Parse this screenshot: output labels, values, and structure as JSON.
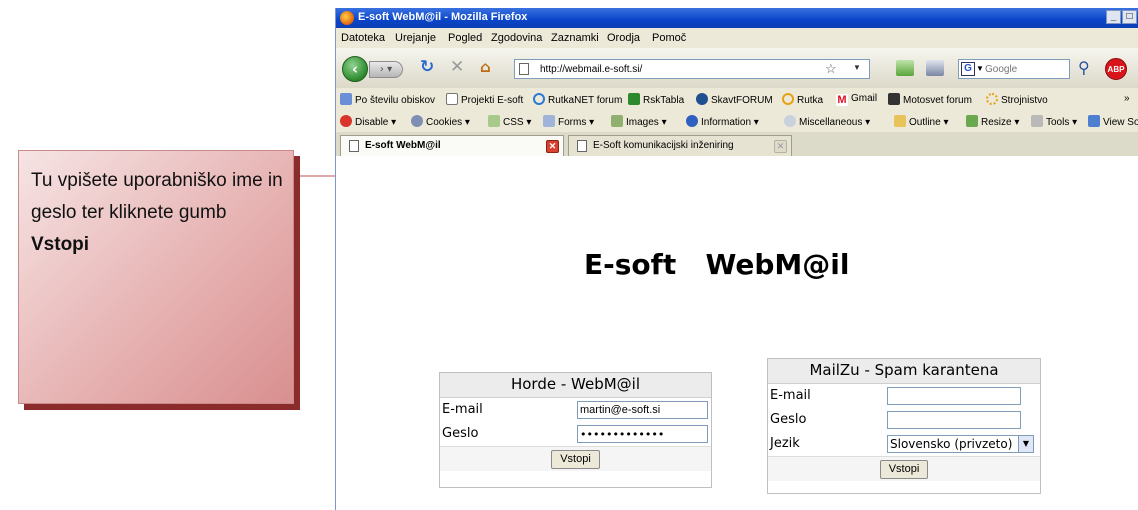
{
  "callout": {
    "text_before": "Tu vpišete uporabniško ime in geslo ter kliknete gumb ",
    "text_bold": "Vstopi"
  },
  "browser": {
    "window_title": "E-soft WebM@il - Mozilla Firefox",
    "menu": [
      "Datoteka",
      "Urejanje",
      "Pogled",
      "Zgodovina",
      "Zaznamki",
      "Orodja",
      "Pomoč"
    ],
    "url": "http://webmail.e-soft.si/",
    "search_placeholder": "Google",
    "bookmarks": [
      "Po številu obiskov",
      "Projekti E-soft",
      "RutkaNET forum",
      "RskTabla",
      "SkavtFORUM",
      "Rutka",
      "Gmail",
      "Motosvet forum",
      "Strojnistvo"
    ],
    "dev_toolbar": [
      "Disable",
      "Cookies",
      "CSS",
      "Forms",
      "Images",
      "Information",
      "Miscellaneous",
      "Outline",
      "Resize",
      "Tools",
      "View Sou"
    ],
    "tabs": [
      "E-soft WebM@il",
      "E-Soft komunikacijski inženiring"
    ],
    "accent_color": "#0a45c8"
  },
  "page": {
    "title": "E-soft   WebM@il"
  },
  "horde": {
    "heading": "Horde - WebM@il",
    "email_label": "E-mail",
    "email_value": "martin@e-soft.si",
    "password_label": "Geslo",
    "password_value": "•••••••••••••",
    "submit_label": "Vstopi"
  },
  "mailzu": {
    "heading": "MailZu - Spam karantena",
    "email_label": "E-mail",
    "email_value": "",
    "password_label": "Geslo",
    "password_value": "",
    "language_label": "Jezik",
    "language_value": "Slovensko (privzeto)",
    "submit_label": "Vstopi"
  }
}
